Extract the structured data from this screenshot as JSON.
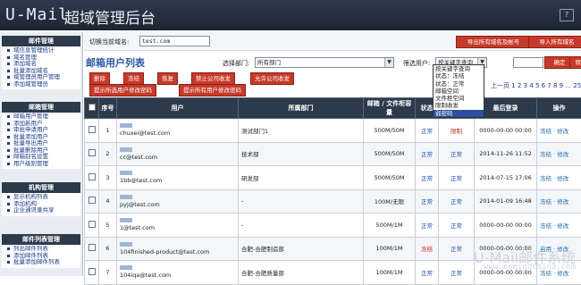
{
  "header": {
    "logo": "U-Mail",
    "system_title": "超域管理后台",
    "help": "?"
  },
  "sidebar": {
    "sections": [
      {
        "title": "邮件管理",
        "items": [
          "域信息管理统计",
          "域名管理",
          "添加域名",
          "批量添加域名",
          "域管理员用户管理",
          "添加域管理员"
        ]
      },
      {
        "title": "邮箱管理",
        "items": [
          "邮箱用户管理",
          "添加新用户",
          "审批申请用户",
          "批量添加用户",
          "批量导出用户",
          "批量删除用户",
          "邮箱别名设置",
          "用户级别管理"
        ]
      },
      {
        "title": "机构管理",
        "items": [
          "显示机构列表",
          "添加机构",
          "企业通讯录共享"
        ]
      },
      {
        "title": "邮件列表管理",
        "items": [
          "列出邮件列表",
          "添加邮件列表",
          "批量添加邮件列表"
        ]
      }
    ]
  },
  "domain_bar": {
    "switch_label": "切换当前域名:",
    "domain_value": "test.com",
    "btn_export": "导出所有域名及帐号",
    "btn_import": "导入所有域名"
  },
  "page_title": "邮箱用户列表",
  "filters": {
    "dept_label": "选择部门:",
    "dept_value": "所有部门",
    "user_label": "筛选用户:",
    "keyword_value": "按关键字查询",
    "ok_button": "确定",
    "ok2_button": "转到"
  },
  "actions": [
    "删除",
    "冻结",
    "恢复",
    "禁止公司收发",
    "允许公司收发",
    "提示所选用户修改密码",
    "提示所有用户修改密码"
  ],
  "dropdown_options": [
    "按关键字查询",
    "状态：冻结",
    "状态：正常",
    "邮箱空间",
    "文件柜空间",
    "限制收发",
    "弱密码"
  ],
  "pager": {
    "text": "上一页 ",
    "pages": "1 2 3 4 5 6 7 8 9 ... 25"
  },
  "table": {
    "headers": [
      "序号",
      "用户",
      "所属部门",
      "邮箱 / 文件柜容量",
      "状态",
      "",
      "最后登录",
      "操作"
    ],
    "rows": [
      {
        "no": "1",
        "user": "chuxei@test.com",
        "dept": "测试部门1",
        "quota": "500M/50M",
        "status": "正常",
        "limit": "限制",
        "login": "0000-00-00 00:00",
        "op": "冻结 · 修改"
      },
      {
        "no": "2",
        "user": "cc@test.com",
        "dept": "技术部",
        "quota": "500M/50M",
        "status": "正常",
        "limit": "正常",
        "login": "2014-11-26 11:52",
        "op": "冻结 · 修改"
      },
      {
        "no": "3",
        "user": "1bb@test.com",
        "dept": "研发部",
        "quota": "500M/50M",
        "status": "正常",
        "limit": "正常",
        "login": "2014-07-15 17:06",
        "op": "冻结 · 修改"
      },
      {
        "no": "4",
        "user": "pyj@test.com",
        "dept": "-",
        "quota": "100M/无限",
        "status": "正常",
        "limit": "正常",
        "login": "2014-01-09 16:48",
        "op": "冻结 · 修改"
      },
      {
        "no": "5",
        "user": "1@test.com",
        "dept": "-",
        "quota": "500M/1M",
        "status": "正常",
        "limit": "正常",
        "login": "0000-00-00 00:00",
        "op": "冻结 · 修改"
      },
      {
        "no": "6",
        "user": "104finished-product@test.com",
        "dept": "合肥-合肥制造部",
        "quota": "100M/1M",
        "status": "冻结",
        "limit": "正常",
        "login": "0000-00-00 00:00",
        "op": "启用 · 修改"
      },
      {
        "no": "7",
        "user": "104iqa@test.com",
        "dept": "合肥-合肥质量部",
        "quota": "100M/1M",
        "status": "正常",
        "limit": "正常",
        "login": "0000-00-00 00:00",
        "op": "冻结 · 修改"
      }
    ]
  },
  "watermark": {
    "brand": "U-Mail邮件系统",
    "url": "www.comingchina.com"
  },
  "colors": {
    "header_bg": "#2d3a4c",
    "accent_red": "#c63a2a",
    "link_blue": "#1a3a8a"
  }
}
